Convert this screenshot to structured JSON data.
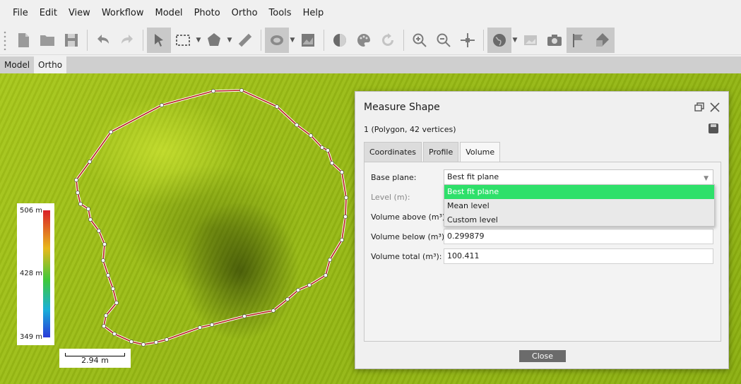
{
  "menu": [
    "File",
    "Edit",
    "View",
    "Workflow",
    "Model",
    "Photo",
    "Ortho",
    "Tools",
    "Help"
  ],
  "menu_underline": [
    "F",
    "E",
    "V",
    "W",
    "M",
    "P",
    "O",
    "T",
    "H"
  ],
  "view_tabs": [
    "Model",
    "Ortho"
  ],
  "active_view_tab": "Ortho",
  "color_scale": {
    "max": "506 m",
    "mid": "428 m",
    "min": "349 m"
  },
  "scale_bar": {
    "label": "2.94 m"
  },
  "dialog": {
    "title": "Measure Shape",
    "subtitle": "1 (Polygon, 42 vertices)",
    "tabs": [
      "Coordinates",
      "Profile",
      "Volume"
    ],
    "active_tab": "Volume",
    "base_plane_label": "Base plane:",
    "base_plane_value": "Best fit plane",
    "base_plane_options": [
      "Best fit plane",
      "Mean level",
      "Custom level"
    ],
    "level_label": "Level (m):",
    "volume_above_label": "Volume above (m³):",
    "volume_below_label": "Volume below (m³):",
    "volume_below_value": "0.299879",
    "volume_total_label": "Volume total (m³):",
    "volume_total_value": "100.411",
    "close_label": "Close"
  },
  "colors": {
    "selected_option": "#2ee06a",
    "polygon": "#b82020",
    "terrain": "#a0c016"
  }
}
